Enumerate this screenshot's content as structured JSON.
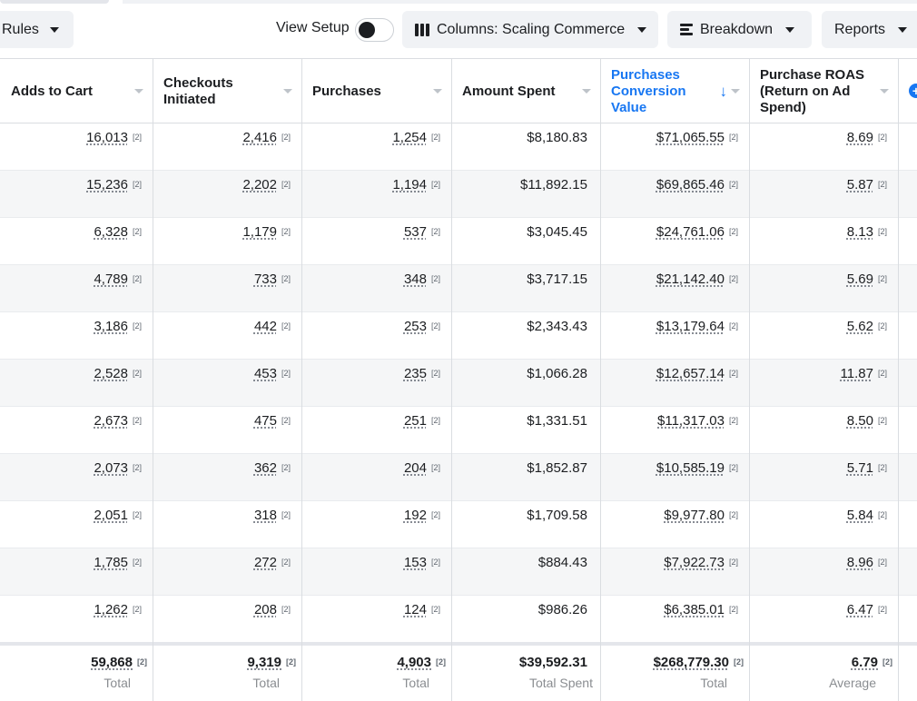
{
  "toolbar": {
    "rules_label": "Rules",
    "view_setup_label": "View Setup",
    "view_setup_on": false,
    "columns_label": "Columns: Scaling Commerce",
    "breakdown_label": "Breakdown",
    "reports_label": "Reports"
  },
  "columns": [
    {
      "key": "adds_to_cart",
      "label": "Adds to Cart"
    },
    {
      "key": "checkouts_initiated",
      "label": "Checkouts Initiated"
    },
    {
      "key": "purchases",
      "label": "Purchases"
    },
    {
      "key": "amount_spent",
      "label": "Amount Spent"
    },
    {
      "key": "purchases_conversion_value",
      "label": "Purchases Conversion Value",
      "sorted": "desc"
    },
    {
      "key": "purchase_roas",
      "label": "Purchase ROAS (Return on Ad Spend)"
    }
  ],
  "note_marker": "[2]",
  "rows": [
    {
      "adds_to_cart": "16,013",
      "checkouts_initiated": "2,416",
      "purchases": "1,254",
      "amount_spent": "$8,180.83",
      "purchases_conversion_value": "$71,065.55",
      "purchase_roas": "8.69"
    },
    {
      "adds_to_cart": "15,236",
      "checkouts_initiated": "2,202",
      "purchases": "1,194",
      "amount_spent": "$11,892.15",
      "purchases_conversion_value": "$69,865.46",
      "purchase_roas": "5.87"
    },
    {
      "adds_to_cart": "6,328",
      "checkouts_initiated": "1,179",
      "purchases": "537",
      "amount_spent": "$3,045.45",
      "purchases_conversion_value": "$24,761.06",
      "purchase_roas": "8.13"
    },
    {
      "adds_to_cart": "4,789",
      "checkouts_initiated": "733",
      "purchases": "348",
      "amount_spent": "$3,717.15",
      "purchases_conversion_value": "$21,142.40",
      "purchase_roas": "5.69"
    },
    {
      "adds_to_cart": "3,186",
      "checkouts_initiated": "442",
      "purchases": "253",
      "amount_spent": "$2,343.43",
      "purchases_conversion_value": "$13,179.64",
      "purchase_roas": "5.62"
    },
    {
      "adds_to_cart": "2,528",
      "checkouts_initiated": "453",
      "purchases": "235",
      "amount_spent": "$1,066.28",
      "purchases_conversion_value": "$12,657.14",
      "purchase_roas": "11.87"
    },
    {
      "adds_to_cart": "2,673",
      "checkouts_initiated": "475",
      "purchases": "251",
      "amount_spent": "$1,331.51",
      "purchases_conversion_value": "$11,317.03",
      "purchase_roas": "8.50"
    },
    {
      "adds_to_cart": "2,073",
      "checkouts_initiated": "362",
      "purchases": "204",
      "amount_spent": "$1,852.87",
      "purchases_conversion_value": "$10,585.19",
      "purchase_roas": "5.71"
    },
    {
      "adds_to_cart": "2,051",
      "checkouts_initiated": "318",
      "purchases": "192",
      "amount_spent": "$1,709.58",
      "purchases_conversion_value": "$9,977.80",
      "purchase_roas": "5.84"
    },
    {
      "adds_to_cart": "1,785",
      "checkouts_initiated": "272",
      "purchases": "153",
      "amount_spent": "$884.43",
      "purchases_conversion_value": "$7,922.73",
      "purchase_roas": "8.96"
    },
    {
      "adds_to_cart": "1,262",
      "checkouts_initiated": "208",
      "purchases": "124",
      "amount_spent": "$986.26",
      "purchases_conversion_value": "$6,385.01",
      "purchase_roas": "6.47"
    }
  ],
  "totals": [
    {
      "value": "59,868",
      "label": "Total"
    },
    {
      "value": "9,319",
      "label": "Total"
    },
    {
      "value": "4,903",
      "label": "Total"
    },
    {
      "value": "$39,592.31",
      "label": "Total Spent"
    },
    {
      "value": "$268,779.30",
      "label": "Total"
    },
    {
      "value": "6.79",
      "label": "Average"
    }
  ]
}
